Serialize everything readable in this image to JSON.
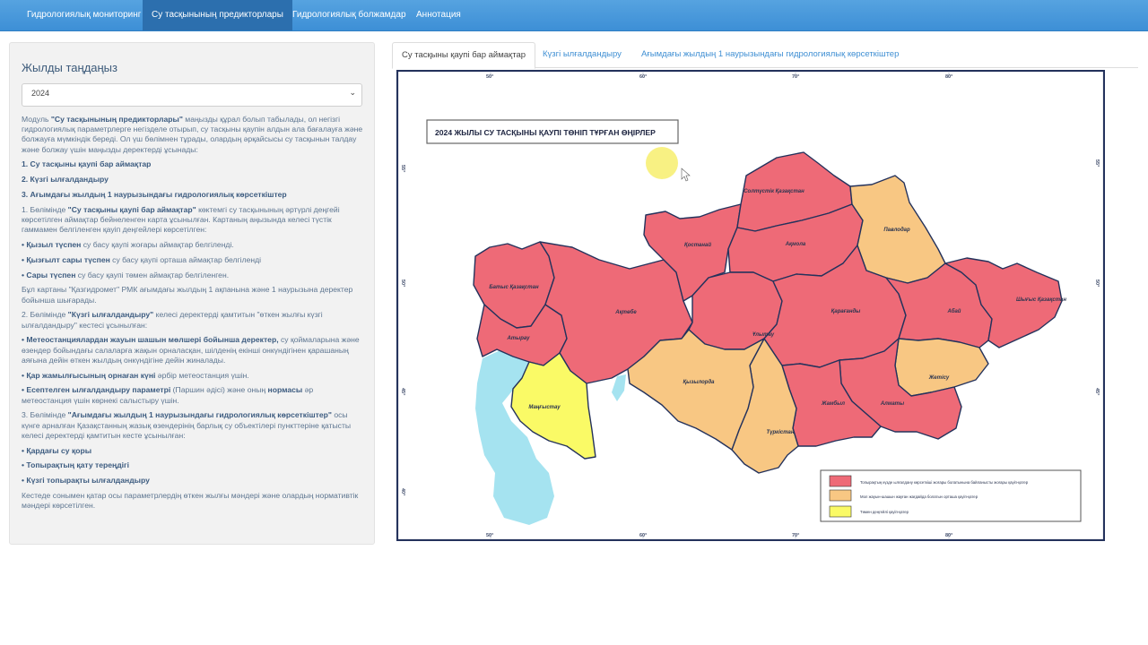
{
  "nav": {
    "items": [
      {
        "label": "Гидрологиялық мониторинг"
      },
      {
        "label": "Су тасқынының предикторлары"
      },
      {
        "label": "Гидрологиялық болжамдар"
      },
      {
        "label": "Аннотация"
      }
    ]
  },
  "sidebar": {
    "title": "Жылды таңдаңыз",
    "year_select": {
      "value": "2024"
    },
    "paragraphs": [
      [
        "Модуль ",
        "**\"Су тасқынының предикторлары\"**",
        " маңызды құрал болып табылады, ол негізгі гидрологиялық параметрлерге негізделе отырып, су тасқыны қаупін алдын ала бағалауға және болжауға мүмкіндік береді. Ол үш бөлімнен тұрады, олардың әрқайсысы су тасқынын талдау және болжау үшін маңызды деректерді ұсынады:"
      ],
      [
        "**1. Су тасқыны қаупі бар аймақтар**"
      ],
      [
        "**2. Күзгі ылғалдандыру**"
      ],
      [
        "**3. Ағымдағы жылдың 1 наурызындағы гидрологиялық көрсеткіштер**"
      ],
      [
        "1. Бөлімінде ",
        "**\"Су тасқыны қаупі бар аймақтар\"**",
        " көктемгі су тасқынының әртүрлі деңгейі көрсетілген аймақтар бейнеленген карта ұсынылған. Картаның аңызында келесі түстік гаммамен белгіленген қауіп деңгейлері көрсетілген:"
      ],
      [
        "**• Қызыл түспен**",
        " су басу қаупі жоғары аймақтар белгіленді."
      ],
      [
        "**• Қызғылт сары түспен**",
        " су басу қаупі орташа аймақтар белгіленді"
      ],
      [
        "**• Сары түспен**",
        " су басу қаупі төмен аймақтар белгіленген."
      ],
      [
        "Бұл картаны \"Қазгидромет\" РМК ағымдағы жылдың 1 ақпанына және 1 наурызына деректер бойынша шығарады."
      ],
      [
        "2. Бөлімінде ",
        "**\"Күзгі ылғалдандыру\"**",
        " келесі деректерді қамтитын \"өткен жылғы күзгі ылғалдандыру\" кестесі ұсынылған:"
      ],
      [
        "**• Метеостанциялардан жауын шашын мөлшері бойынша деректер,**",
        " су қоймаларына және өзендер бойындағы салаларға жақын орналасқан, шілденің екінші онкүндігінен қарашаның аяғына дейін өткен жылдың онкүндігіне дейін жиналады."
      ],
      [
        "**• Қар жамылғысының орнаған күні**",
        " әрбір метеостанция үшін."
      ],
      [
        "**• Есептелген ылғалдандыру параметрі**",
        " (Паршин әдісі) және оның ",
        "**нормасы**",
        " әр метеостанция үшін көрнекі салыстыру үшін."
      ],
      [
        "3. Бөлімінде ",
        "**\"Ағымдағы жылдың 1 наурызындағы гидрологиялық көрсеткіштер\"**",
        " осы күнге арналған Қазақстанның жазық өзендерінің барлық су объектілері пункттеріне қатысты келесі деректерді қамтитын кесте ұсынылған:"
      ],
      [
        "**• Қардағы су қоры**"
      ],
      [
        "**• Топырақтың қату тереңдігі**"
      ],
      [
        "**• Күзгі топырақты ылғалдандыру**"
      ],
      [
        "Кестеде сонымен қатар осы параметрлердің өткен жылғы мәндері және олардың нормативтік мәндері көрсетілген."
      ]
    ]
  },
  "tabs": [
    {
      "label": "Су тасқыны қаупі бар аймақтар"
    },
    {
      "label": "Күзгі ылғалдандыру"
    },
    {
      "label": "Ағымдағы жылдың 1 наурызындағы гидрологиялық көрсеткіштер"
    }
  ],
  "map": {
    "title": "2024 ЖЫЛЫ СУ ТАСҚЫНЫ ҚАУПІ ТӨНІП ТҰРҒАН ӨҢІРЛЕР",
    "lon_labels": [
      "50°",
      "60°",
      "70°",
      "80°"
    ],
    "lat_labels": [
      "55°",
      "50°",
      "45°",
      "40°"
    ],
    "regions": {
      "north_kz": "Солтүстік Қазақстан",
      "kostanay": "Қостанай",
      "akmola": "Ақмола",
      "pavlodar": "Павлодар",
      "west_kz": "Батыс Қазақстан",
      "aktobe": "Ақтөбе",
      "karaganda": "Қарағанды",
      "abai": "Абай",
      "east_kz": "Шығыс Қазақстан",
      "atyrau": "Атырау",
      "ulytau": "Ұлытау",
      "kyzylorda": "Қызылорда",
      "zhetisu": "Жетісу",
      "mangystau": "Маңғыстау",
      "zhambyl": "Жамбыл",
      "almaty": "Алматы",
      "turkistan": "Түркістан"
    },
    "legend": [
      {
        "label": "Топырақтың күзде ылғалдану көрсеткіші жоғары болатынына байланысты жоғары қауіп-қатер",
        "color": "#ee6a77"
      },
      {
        "label": "Мол жауын-шашын жауған жағдайда болатын орташа қауіп-қатер",
        "color": "#f8c783"
      },
      {
        "label": "Төмен деңгейлі қауіп-қатер",
        "color": "#fafa66"
      }
    ],
    "colors": {
      "high": "#ee6a77",
      "medium": "#f8c783",
      "low": "#fafa66",
      "water": "#a5e3f0",
      "border": "#24325c"
    }
  }
}
